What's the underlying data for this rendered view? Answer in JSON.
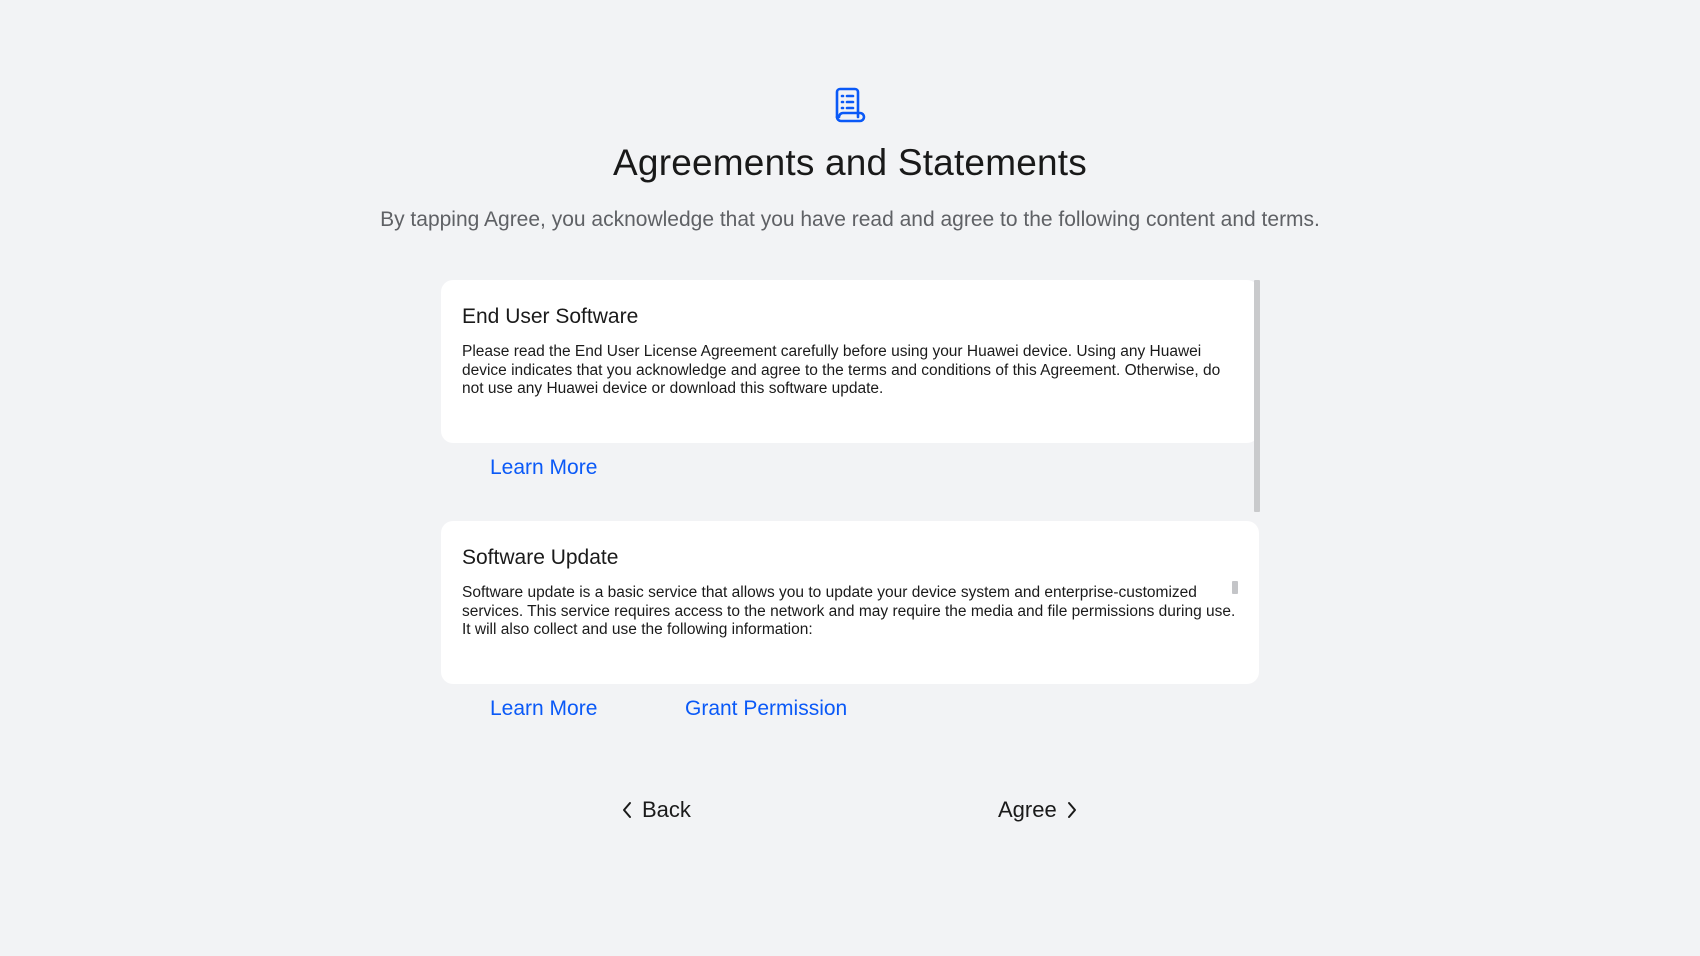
{
  "page": {
    "icon": "document-list-icon",
    "title": "Agreements and Statements",
    "subtitle": "By tapping Agree, you acknowledge that you have read and agree to the following content and terms."
  },
  "agreements": [
    {
      "title": "End User Software",
      "body": "Please read the End User License Agreement carefully before using your Huawei device. Using any Huawei device indicates that you acknowledge and agree to the terms and conditions of this Agreement. Otherwise, do not use any Huawei device or download this software update.",
      "learn_more": "Learn More"
    },
    {
      "title": "Software Update",
      "body": "Software update is a basic service that allows you to update your device system and enterprise-customized services. This service requires access to the network and may require the media and file permissions during use. It will also collect and use the following information:",
      "learn_more": "Learn More",
      "grant_permission": "Grant Permission"
    }
  ],
  "footer": {
    "back_label": "Back",
    "agree_label": "Agree"
  },
  "colors": {
    "background": "#f2f3f5",
    "card": "#ffffff",
    "accent": "#0a59f7",
    "text": "#1a1a1a",
    "subtext": "#5f6165"
  }
}
